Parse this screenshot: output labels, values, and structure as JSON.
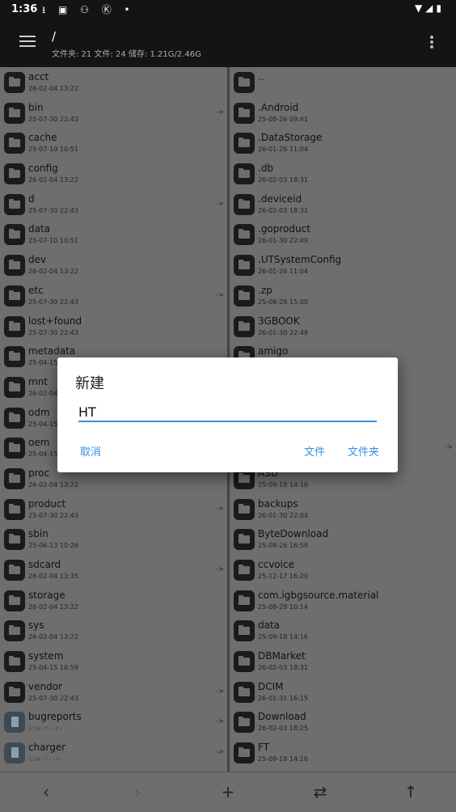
{
  "status_bar": {
    "time": "1:36",
    "left_icons": "⭳ ▣ ⚇ Ⓚ •",
    "right_icons": "▼◢▮"
  },
  "app_bar": {
    "path": "/",
    "summary": "文件夹: 21  文件: 24  储存: 1.21G/2.46G"
  },
  "left_pane": [
    {
      "name": "acct",
      "meta": "26-02-04 13:22",
      "type": "folder",
      "link": ""
    },
    {
      "name": "bin",
      "meta": "25-07-30 22:43",
      "type": "folder",
      "link": "->"
    },
    {
      "name": "cache",
      "meta": "25-07-10 10:51",
      "type": "folder",
      "link": ""
    },
    {
      "name": "config",
      "meta": "26-02-04 13:22",
      "type": "folder",
      "link": ""
    },
    {
      "name": "d",
      "meta": "25-07-30 22:43",
      "type": "folder",
      "link": "->"
    },
    {
      "name": "data",
      "meta": "25-07-10 10:51",
      "type": "folder",
      "link": ""
    },
    {
      "name": "dev",
      "meta": "26-02-04 13:22",
      "type": "folder",
      "link": ""
    },
    {
      "name": "etc",
      "meta": "25-07-30 22:43",
      "type": "folder",
      "link": "->"
    },
    {
      "name": "lost+found",
      "meta": "25-07-30 22:43",
      "type": "folder",
      "link": ""
    },
    {
      "name": "metadata",
      "meta": "25-04-15",
      "type": "folder",
      "link": ""
    },
    {
      "name": "mnt",
      "meta": "26-02-04",
      "type": "folder",
      "link": ""
    },
    {
      "name": "odm",
      "meta": "25-04-15",
      "type": "folder",
      "link": ""
    },
    {
      "name": "oem",
      "meta": "25-04-15",
      "type": "folder",
      "link": ""
    },
    {
      "name": "proc",
      "meta": "26-02-04 13:22",
      "type": "folder",
      "link": ""
    },
    {
      "name": "product",
      "meta": "25-07-30 22:43",
      "type": "folder",
      "link": "->"
    },
    {
      "name": "sbin",
      "meta": "25-06-13 10:26",
      "type": "folder",
      "link": ""
    },
    {
      "name": "sdcard",
      "meta": "26-02-04 13:35",
      "type": "folder",
      "link": "->"
    },
    {
      "name": "storage",
      "meta": "26-02-04 13:22",
      "type": "folder",
      "link": ""
    },
    {
      "name": "sys",
      "meta": "26-02-04 13:22",
      "type": "folder",
      "link": ""
    },
    {
      "name": "system",
      "meta": "25-04-15 16:59",
      "type": "folder",
      "link": ""
    },
    {
      "name": "vendor",
      "meta": "25-07-30 22:43",
      "type": "folder",
      "link": "->"
    },
    {
      "name": "bugreports",
      "meta": "lrw-r--r--",
      "type": "file",
      "link": "->"
    },
    {
      "name": "charger",
      "meta": "lrw-r--r--",
      "type": "file",
      "link": "->"
    }
  ],
  "right_pane": [
    {
      "name": "..",
      "meta": "",
      "type": "folder",
      "link": ""
    },
    {
      "name": ".Android",
      "meta": "25-08-26 09:41",
      "type": "folder",
      "link": ""
    },
    {
      "name": ".DataStorage",
      "meta": "26-01-26 11:04",
      "type": "folder",
      "link": ""
    },
    {
      "name": ".db",
      "meta": "26-02-03 18:31",
      "type": "folder",
      "link": ""
    },
    {
      "name": ".deviceid",
      "meta": "26-02-03 18:31",
      "type": "folder",
      "link": ""
    },
    {
      "name": ".goproduct",
      "meta": "26-01-30 22:49",
      "type": "folder",
      "link": ""
    },
    {
      "name": ".UTSystemConfig",
      "meta": "26-01-26 11:04",
      "type": "folder",
      "link": ""
    },
    {
      "name": ".zp",
      "meta": "25-08-28 15:00",
      "type": "folder",
      "link": ""
    },
    {
      "name": "3GBOOK",
      "meta": "26-01-30 22:49",
      "type": "folder",
      "link": ""
    },
    {
      "name": "amigo",
      "meta": "",
      "type": "folder",
      "link": ""
    },
    {
      "name": "",
      "meta": "",
      "type": "folder",
      "link": ""
    },
    {
      "name": "",
      "meta": "",
      "type": "folder",
      "link": ""
    },
    {
      "name": "",
      "meta": "",
      "type": "folder",
      "link": "->"
    },
    {
      "name": "ASD",
      "meta": "25-09-18 14:16",
      "type": "folder",
      "link": ""
    },
    {
      "name": "backups",
      "meta": "26-01-30 22:04",
      "type": "folder",
      "link": ""
    },
    {
      "name": "ByteDownload",
      "meta": "25-08-26 16:59",
      "type": "folder",
      "link": ""
    },
    {
      "name": "ccvoice",
      "meta": "25-12-17 16:20",
      "type": "folder",
      "link": ""
    },
    {
      "name": "com.igbgsource.material",
      "meta": "25-08-28 10:14",
      "type": "folder",
      "link": ""
    },
    {
      "name": "data",
      "meta": "25-09-18 14:16",
      "type": "folder",
      "link": ""
    },
    {
      "name": "DBMarket",
      "meta": "26-02-03 18:31",
      "type": "folder",
      "link": ""
    },
    {
      "name": "DCIM",
      "meta": "26-01-31 16:15",
      "type": "folder",
      "link": ""
    },
    {
      "name": "Download",
      "meta": "26-02-03 18:25",
      "type": "folder",
      "link": ""
    },
    {
      "name": "FT",
      "meta": "25-09-18 14:16",
      "type": "folder",
      "link": ""
    }
  ],
  "dialog": {
    "title": "新建",
    "input_value": "HT",
    "cancel": "取消",
    "file": "文件",
    "folder": "文件夹"
  },
  "bottom_bar": {
    "back": "‹",
    "forward": "›",
    "add": "+",
    "swap": "⇄",
    "up": "↑"
  }
}
